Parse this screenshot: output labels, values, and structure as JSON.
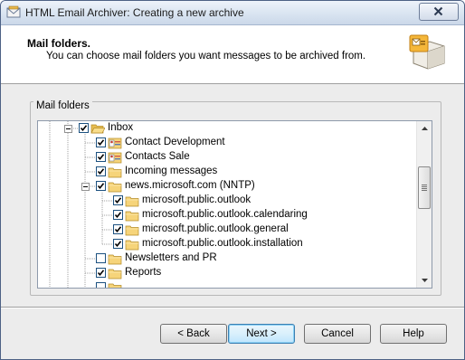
{
  "window": {
    "title": "HTML Email Archiver: Creating a new archive"
  },
  "header": {
    "title": "Mail folders.",
    "subtitle": "You can choose mail folders you want messages to be archived from."
  },
  "group": {
    "label": "Mail folders"
  },
  "tree": {
    "items": [
      {
        "label": "Inbox",
        "checked": true,
        "icon": "open-folder-icon"
      },
      {
        "label": "Contact Development",
        "checked": true,
        "icon": "contacts-folder-icon"
      },
      {
        "label": "Contacts Sale",
        "checked": true,
        "icon": "contacts-folder-icon"
      },
      {
        "label": "Incoming messages",
        "checked": true,
        "icon": "folder-icon"
      },
      {
        "label": "news.microsoft.com (NNTP)",
        "checked": true,
        "icon": "folder-icon"
      },
      {
        "label": "microsoft.public.outlook",
        "checked": true,
        "icon": "folder-icon"
      },
      {
        "label": "microsoft.public.outlook.calendaring",
        "checked": true,
        "icon": "folder-icon"
      },
      {
        "label": "microsoft.public.outlook.general",
        "checked": true,
        "icon": "folder-icon"
      },
      {
        "label": "microsoft.public.outlook.installation",
        "checked": true,
        "icon": "folder-icon"
      },
      {
        "label": "Newsletters and PR",
        "checked": false,
        "icon": "folder-icon"
      },
      {
        "label": "Reports",
        "checked": true,
        "icon": "folder-icon"
      }
    ]
  },
  "buttons": {
    "back": "< Back",
    "next": "Next >",
    "cancel": "Cancel",
    "help": "Help"
  },
  "colors": {
    "title_bar": "#d9e4f1",
    "folder_yellow": "#f6d47a",
    "default_button": "#bee6fd"
  }
}
